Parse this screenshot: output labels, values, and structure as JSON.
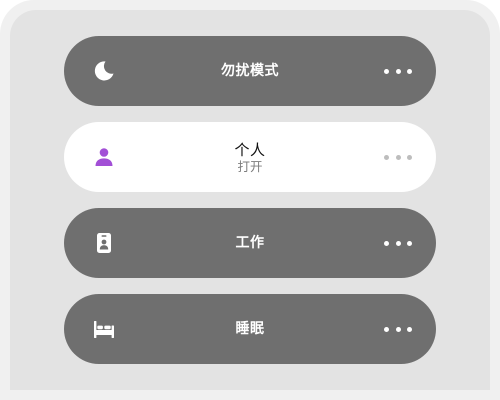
{
  "focus_modes": [
    {
      "id": "dnd",
      "icon": "moon-icon",
      "title": "勿扰模式",
      "subtitle": "",
      "active": false
    },
    {
      "id": "personal",
      "icon": "person-icon",
      "title": "个人",
      "subtitle": "打开",
      "active": true,
      "accent": "#a24fd6"
    },
    {
      "id": "work",
      "icon": "id-badge-icon",
      "title": "工作",
      "subtitle": "",
      "active": false
    },
    {
      "id": "sleep",
      "icon": "bed-icon",
      "title": "睡眠",
      "subtitle": "",
      "active": false
    }
  ],
  "more_icon": "more-dots-icon",
  "colors": {
    "inactive_tile": "#6f6f6f",
    "active_tile": "#ffffff",
    "panel_bg": "#e3e3e3"
  }
}
